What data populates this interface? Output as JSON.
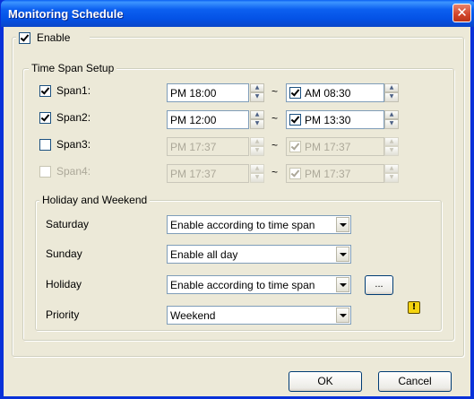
{
  "window": {
    "title": "Monitoring Schedule",
    "close_glyph": "✕"
  },
  "enable": {
    "label": "Enable",
    "checked": true
  },
  "time_span": {
    "title": "Time Span Setup",
    "separator": "~",
    "spans": [
      {
        "label": "Span1:",
        "checked": true,
        "enabled": true,
        "start": "PM 18:00",
        "end": "AM 08:30",
        "end_checked": true,
        "end_enabled": true
      },
      {
        "label": "Span2:",
        "checked": true,
        "enabled": true,
        "start": "PM 12:00",
        "end": "PM 13:30",
        "end_checked": true,
        "end_enabled": true
      },
      {
        "label": "Span3:",
        "checked": false,
        "enabled": true,
        "start": "PM 17:37",
        "end": "PM 17:37",
        "end_checked": true,
        "end_enabled": false
      },
      {
        "label": "Span4:",
        "checked": false,
        "enabled": false,
        "start": "PM 17:37",
        "end": "PM 17:37",
        "end_checked": true,
        "end_enabled": false
      }
    ]
  },
  "holiday": {
    "title": "Holiday and Weekend",
    "rows": [
      {
        "label": "Saturday",
        "value": "Enable according to time span"
      },
      {
        "label": "Sunday",
        "value": "Enable all day"
      },
      {
        "label": "Holiday",
        "value": "Enable according to time span"
      },
      {
        "label": "Priority",
        "value": "Weekend"
      }
    ],
    "browse_label": "...",
    "warning_glyph": "!"
  },
  "buttons": {
    "ok": "OK",
    "cancel": "Cancel"
  },
  "colors": {
    "title_bar": "#0a5ff2",
    "client_bg": "#ece9d8",
    "close": "#d0442a",
    "warning": "#f5d40f"
  }
}
